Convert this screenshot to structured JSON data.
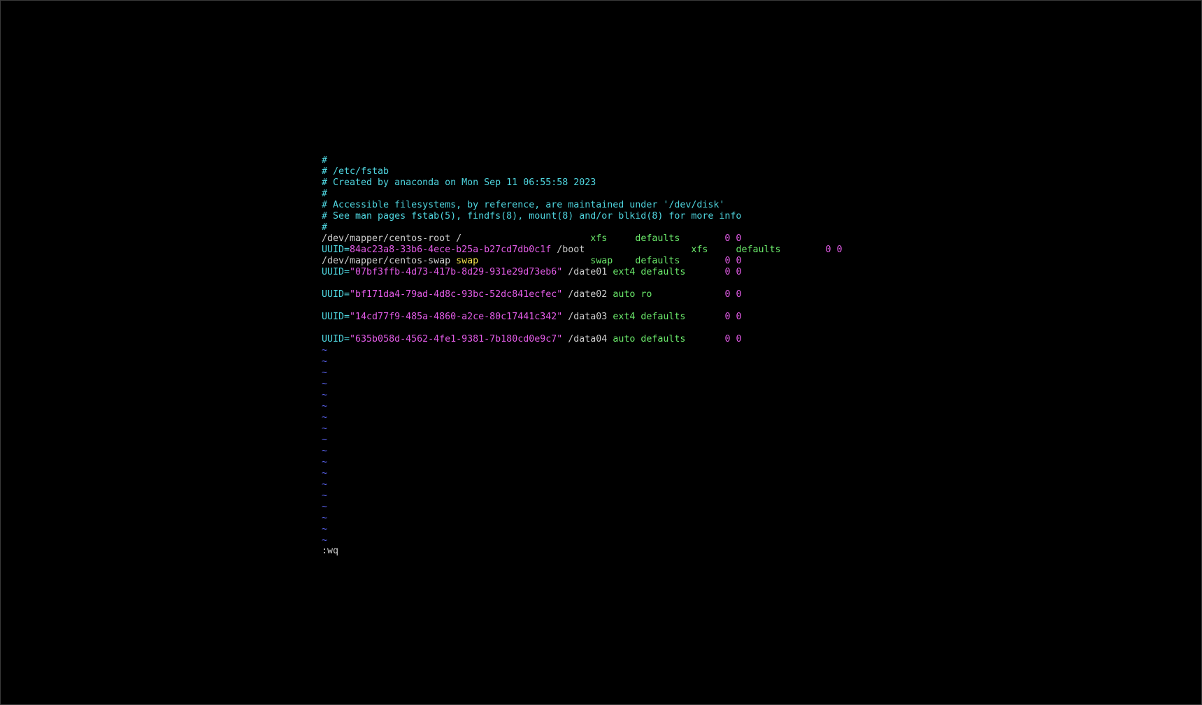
{
  "colors": {
    "comment": "#4fd6e0",
    "text": "#cfcfcf",
    "keyword": "#6bea6b",
    "magenta": "#e45ce8",
    "yellow": "#f2e14b",
    "tilde": "#5a63f0",
    "cmd": "#d0d0d0"
  },
  "lines": [
    [
      {
        "t": "#",
        "c": "comment"
      }
    ],
    [
      {
        "t": "# /etc/fstab",
        "c": "comment"
      }
    ],
    [
      {
        "t": "# Created by anaconda on Mon Sep 11 06:55:58 2023",
        "c": "comment"
      }
    ],
    [
      {
        "t": "#",
        "c": "comment"
      }
    ],
    [
      {
        "t": "# Accessible filesystems, by reference, are maintained under '/dev/disk'",
        "c": "comment"
      }
    ],
    [
      {
        "t": "# See man pages fstab(5), findfs(8), mount(8) and/or blkid(8) for more info",
        "c": "comment"
      }
    ],
    [
      {
        "t": "#",
        "c": "comment"
      }
    ],
    [
      {
        "t": "/dev/mapper/centos-root /                       ",
        "c": "text"
      },
      {
        "t": "xfs",
        "c": "keyword"
      },
      {
        "t": "     ",
        "c": "text"
      },
      {
        "t": "defaults",
        "c": "keyword"
      },
      {
        "t": "        ",
        "c": "text"
      },
      {
        "t": "0 0",
        "c": "magenta"
      }
    ],
    [
      {
        "t": "UUID=",
        "c": "comment"
      },
      {
        "t": "84ac23a8-33b6-4ece-b25a-b27cd7db0c1f",
        "c": "magenta"
      },
      {
        "t": " /boot                   ",
        "c": "text"
      },
      {
        "t": "xfs",
        "c": "keyword"
      },
      {
        "t": "     ",
        "c": "text"
      },
      {
        "t": "defaults",
        "c": "keyword"
      },
      {
        "t": "        ",
        "c": "text"
      },
      {
        "t": "0 0",
        "c": "magenta"
      }
    ],
    [
      {
        "t": "/dev/mapper/centos-swap ",
        "c": "text"
      },
      {
        "t": "swap",
        "c": "yellow"
      },
      {
        "t": "                    ",
        "c": "text"
      },
      {
        "t": "swap",
        "c": "keyword"
      },
      {
        "t": "    ",
        "c": "text"
      },
      {
        "t": "defaults",
        "c": "keyword"
      },
      {
        "t": "        ",
        "c": "text"
      },
      {
        "t": "0 0",
        "c": "magenta"
      }
    ],
    [
      {
        "t": "UUID=",
        "c": "comment"
      },
      {
        "t": "\"07bf3ffb-4d73-417b-8d29-931e29d73eb6\"",
        "c": "magenta"
      },
      {
        "t": " /date01 ",
        "c": "text"
      },
      {
        "t": "ext4",
        "c": "keyword"
      },
      {
        "t": " ",
        "c": "text"
      },
      {
        "t": "defaults",
        "c": "keyword"
      },
      {
        "t": "       ",
        "c": "text"
      },
      {
        "t": "0 0",
        "c": "magenta"
      }
    ],
    [],
    [
      {
        "t": "UUID=",
        "c": "comment"
      },
      {
        "t": "\"bf171da4-79ad-4d8c-93bc-52dc841ecfec\"",
        "c": "magenta"
      },
      {
        "t": " /date02 ",
        "c": "text"
      },
      {
        "t": "auto",
        "c": "keyword"
      },
      {
        "t": " ",
        "c": "text"
      },
      {
        "t": "ro",
        "c": "keyword"
      },
      {
        "t": "             ",
        "c": "text"
      },
      {
        "t": "0 0",
        "c": "magenta"
      }
    ],
    [],
    [
      {
        "t": "UUID=",
        "c": "comment"
      },
      {
        "t": "\"14cd77f9-485a-4860-a2ce-80c17441c342\"",
        "c": "magenta"
      },
      {
        "t": " /data03 ",
        "c": "text"
      },
      {
        "t": "ext4",
        "c": "keyword"
      },
      {
        "t": " ",
        "c": "text"
      },
      {
        "t": "defaults",
        "c": "keyword"
      },
      {
        "t": "       ",
        "c": "text"
      },
      {
        "t": "0 0",
        "c": "magenta"
      }
    ],
    [],
    [
      {
        "t": "UUID=",
        "c": "comment"
      },
      {
        "t": "\"635b058d-4562-4fe1-9381-7b180cd0e9c7\"",
        "c": "magenta"
      },
      {
        "t": " /data04 ",
        "c": "text"
      },
      {
        "t": "auto",
        "c": "keyword"
      },
      {
        "t": " ",
        "c": "text"
      },
      {
        "t": "defaults",
        "c": "keyword"
      },
      {
        "t": "       ",
        "c": "text"
      },
      {
        "t": "0 0",
        "c": "magenta"
      }
    ],
    [
      {
        "t": "~",
        "c": "tilde"
      }
    ],
    [
      {
        "t": "~",
        "c": "tilde"
      }
    ],
    [
      {
        "t": "~",
        "c": "tilde"
      }
    ],
    [
      {
        "t": "~",
        "c": "tilde"
      }
    ],
    [
      {
        "t": "~",
        "c": "tilde"
      }
    ],
    [
      {
        "t": "~",
        "c": "tilde"
      }
    ],
    [
      {
        "t": "~",
        "c": "tilde"
      }
    ],
    [
      {
        "t": "~",
        "c": "tilde"
      }
    ],
    [
      {
        "t": "~",
        "c": "tilde"
      }
    ],
    [
      {
        "t": "~",
        "c": "tilde"
      }
    ],
    [
      {
        "t": "~",
        "c": "tilde"
      }
    ],
    [
      {
        "t": "~",
        "c": "tilde"
      }
    ],
    [
      {
        "t": "~",
        "c": "tilde"
      }
    ],
    [
      {
        "t": "~",
        "c": "tilde"
      }
    ],
    [
      {
        "t": "~",
        "c": "tilde"
      }
    ],
    [
      {
        "t": "~",
        "c": "tilde"
      }
    ],
    [
      {
        "t": "~",
        "c": "tilde"
      }
    ],
    [
      {
        "t": "~",
        "c": "tilde"
      }
    ]
  ],
  "command_line": ":wq"
}
